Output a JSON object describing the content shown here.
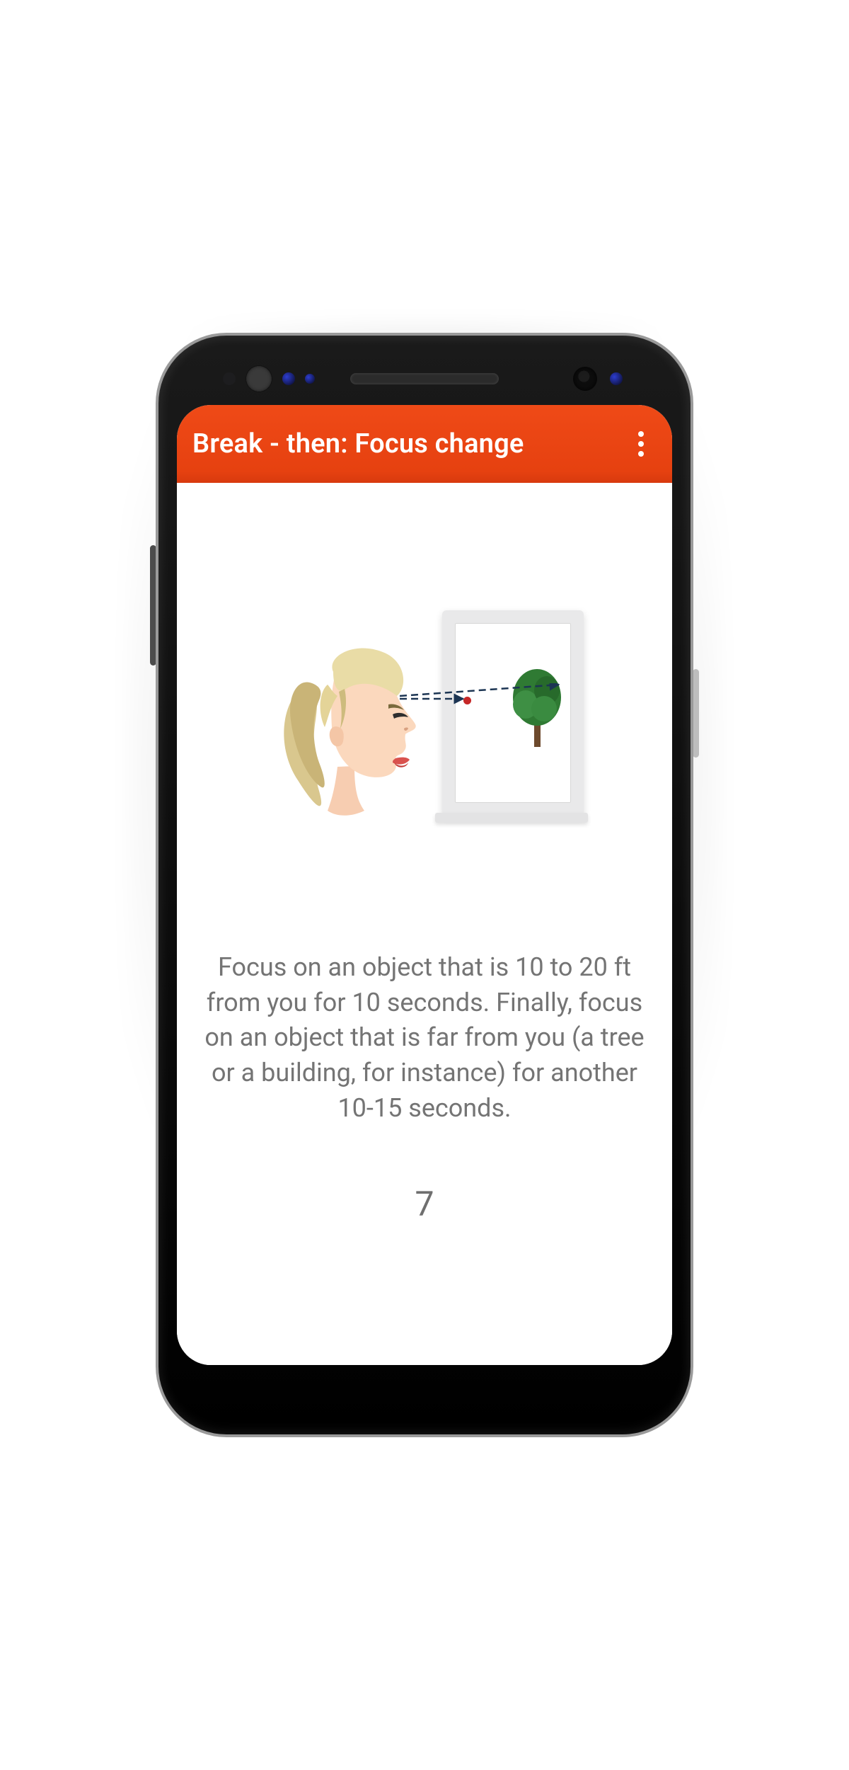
{
  "appbar": {
    "title": "Break - then: Focus change",
    "overflow_button_label": "More options"
  },
  "exercise": {
    "instruction": "Focus on an object that is 10 to 20 ft from you for 10 seconds. Finally, focus on an object that is far from you (a tree or a building, for instance) for another 10-15 seconds.",
    "countdown_seconds": "7",
    "illustration_description": "person-profile-looking-through-window-at-distant-tree"
  },
  "colors": {
    "appbar_bg": "#e94515",
    "text_muted": "#747474"
  }
}
